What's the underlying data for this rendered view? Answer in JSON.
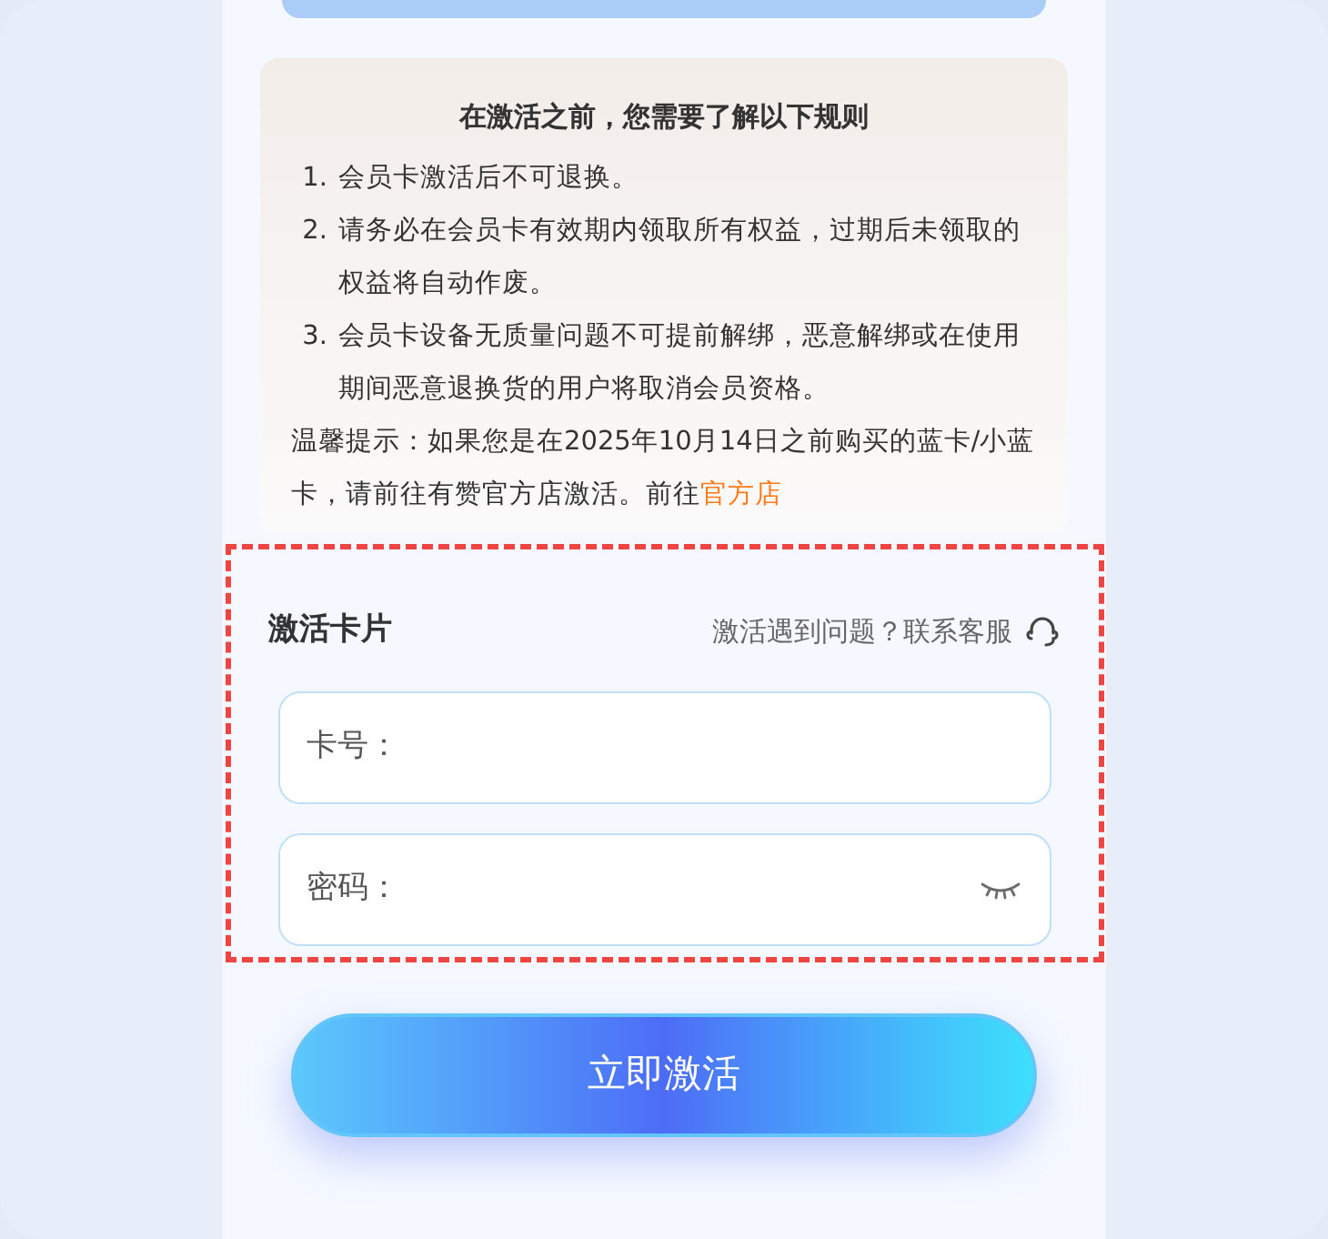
{
  "rules": {
    "title": "在激活之前，您需要了解以下规则",
    "items": [
      {
        "number": "1.",
        "text": "会员卡激活后不可退换。"
      },
      {
        "number": "2.",
        "text": "请务必在会员卡有效期内领取所有权益，过期后未领取的权益将自动作废。"
      },
      {
        "number": "3.",
        "text": "会员卡设备无质量问题不可提前解绑，恶意解绑或在使用期间恶意退换货的用户将取消会员资格。"
      }
    ],
    "tip": "温馨提示：如果您是在2025年10月14日之前购买的蓝卡/小蓝卡，请前往有赞官方店激活。前往",
    "tip_link": "官方店"
  },
  "activation": {
    "title": "激活卡片",
    "help": "激活遇到问题？联系客服",
    "fields": [
      {
        "kind": "text",
        "label": "卡号："
      },
      {
        "kind": "password",
        "label": "密码："
      }
    ]
  },
  "submit_button": "立即激活"
}
